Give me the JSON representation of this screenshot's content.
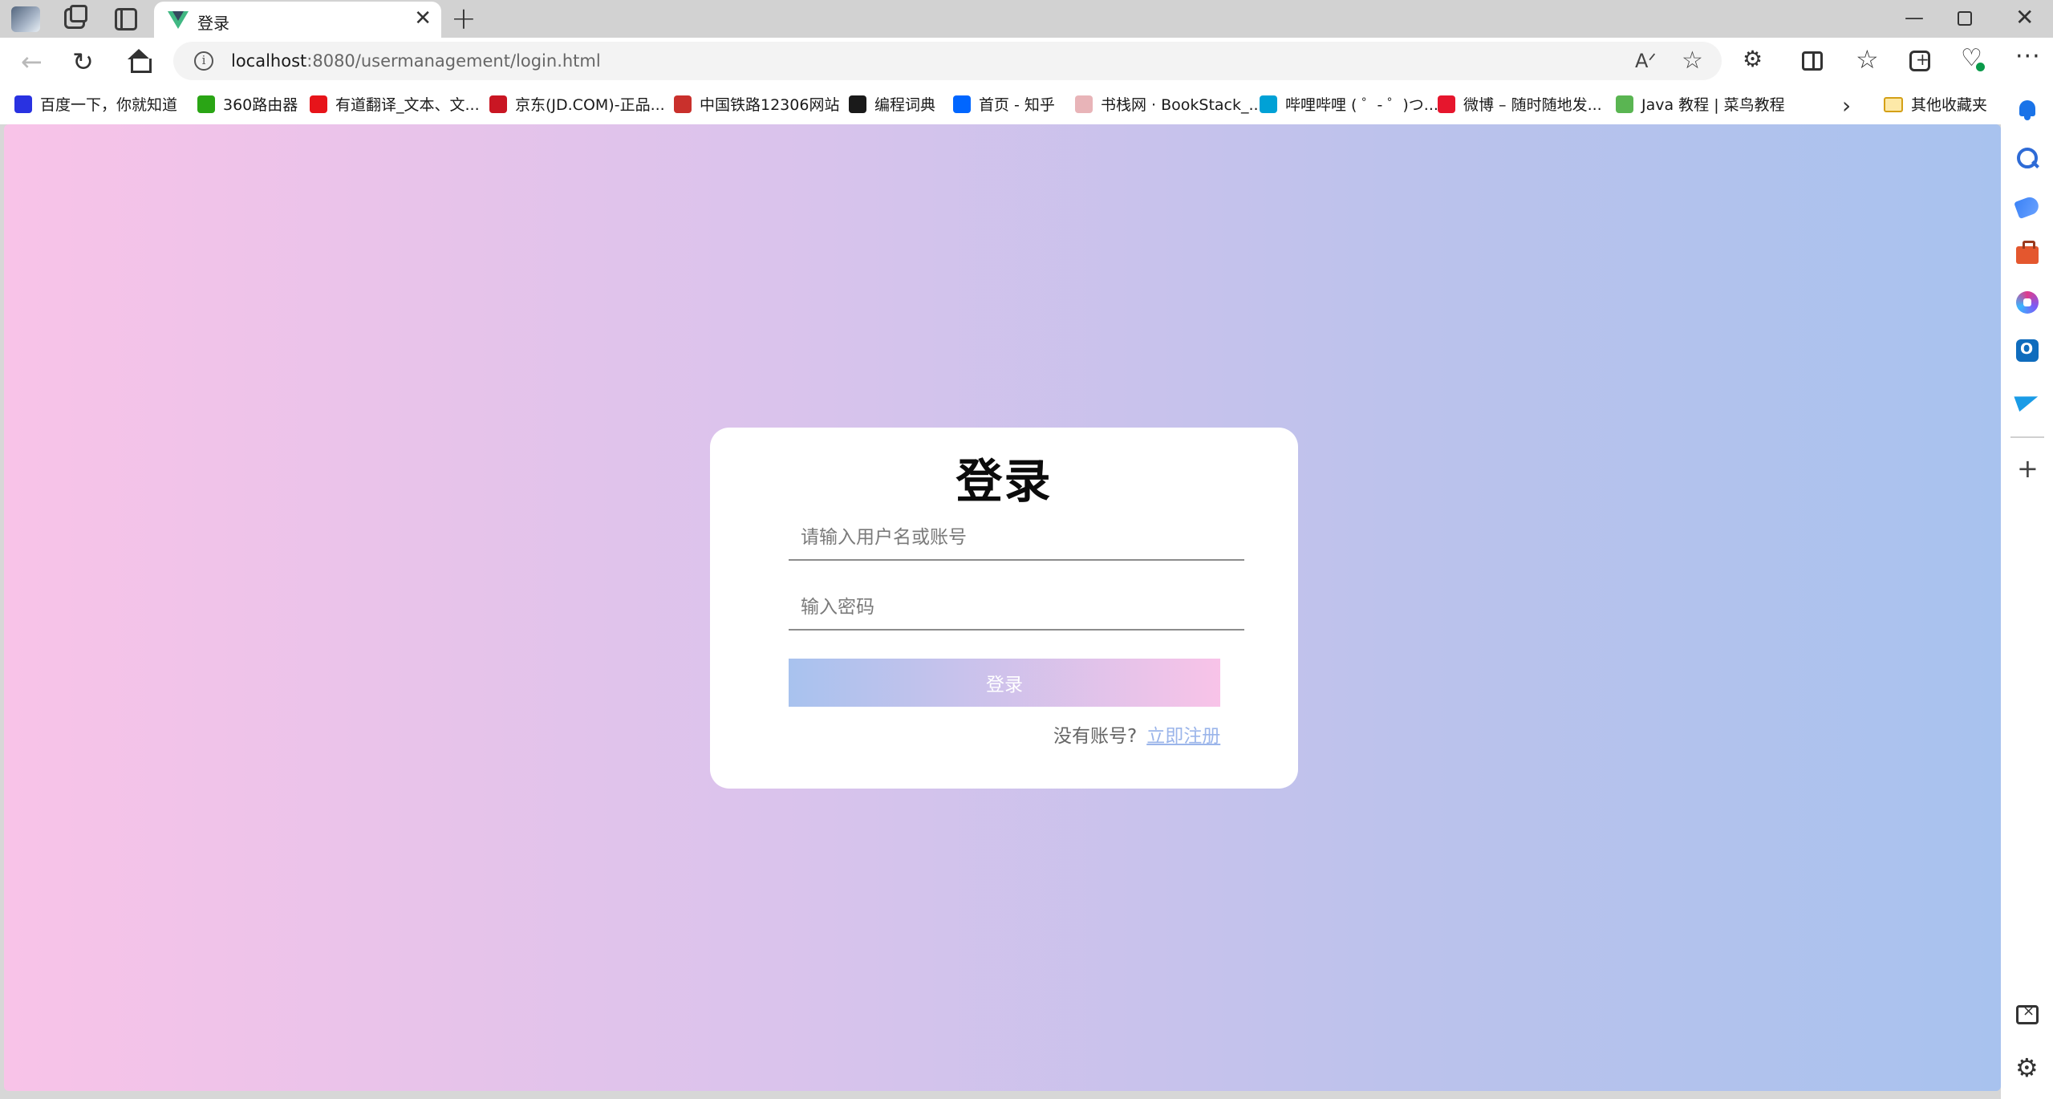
{
  "browser": {
    "tab": {
      "title": "登录",
      "favicon": "vue-logo-icon"
    },
    "address": {
      "host": "localhost",
      "rest": ":8080/usermanagement/login.html"
    },
    "bookmarks": [
      {
        "label": "百度一下，你就知道",
        "icon": "baidu-paw-icon",
        "color": "#2932e1"
      },
      {
        "label": "360路由器",
        "icon": "router-360-icon",
        "color": "#2aa515"
      },
      {
        "label": "有道翻译_文本、文...",
        "icon": "youdao-icon",
        "color": "#e7141a"
      },
      {
        "label": "京东(JD.COM)-正品...",
        "icon": "jd-icon",
        "color": "#c91623"
      },
      {
        "label": "中国铁路12306网站",
        "icon": "railway-icon",
        "color": "#c9302c"
      },
      {
        "label": "编程词典",
        "icon": "dictionary-icon",
        "color": "#1a1a1a"
      },
      {
        "label": "首页 - 知乎",
        "icon": "zhihu-icon",
        "color": "#0066ff"
      },
      {
        "label": "书栈网 · BookStack_...",
        "icon": "bookstack-icon",
        "color": "#e8b4b8"
      },
      {
        "label": "哔哩哔哩 ( ゜- ゜)つ...",
        "icon": "bilibili-icon",
        "color": "#00a1d6"
      },
      {
        "label": "微博 – 随时随地发...",
        "icon": "weibo-icon",
        "color": "#e6162d"
      },
      {
        "label": "Java 教程 | 菜鸟教程",
        "icon": "runoob-icon",
        "color": "#5ab552"
      }
    ],
    "bookmarks_folder": "其他收藏夹"
  },
  "login": {
    "title": "登录",
    "username_placeholder": "请输入用户名或账号",
    "password_placeholder": "输入密码",
    "button_label": "登录",
    "no_account_text": "没有账号?",
    "register_link": "立即注册"
  },
  "colors": {
    "gradient_pink": "#f8c3e8",
    "gradient_blue": "#a8c2ee",
    "link": "#9bb5ea"
  }
}
